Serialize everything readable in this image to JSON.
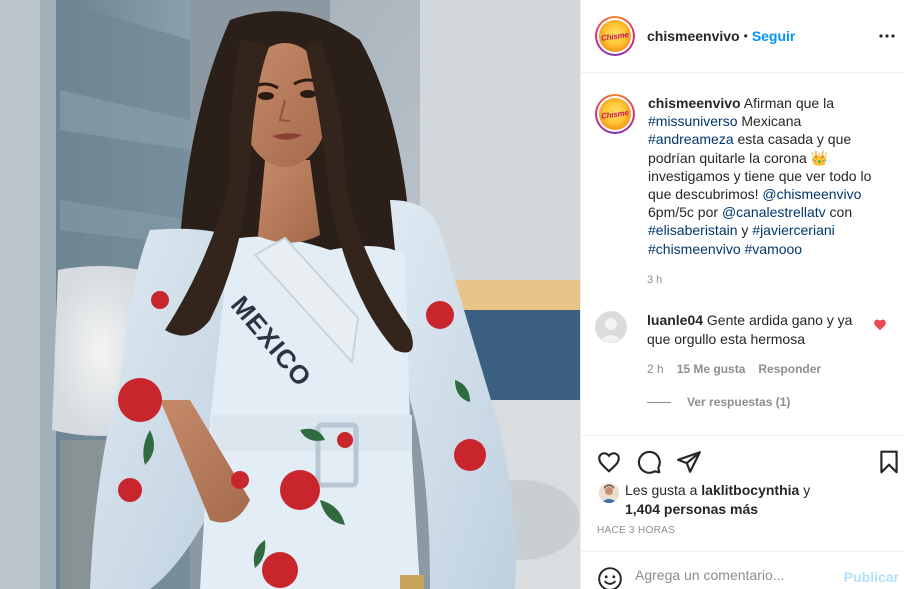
{
  "header": {
    "username": "chismeenvivo",
    "separator": "•",
    "follow_label": "Seguir",
    "more_icon": "more-horizontal-icon"
  },
  "caption": {
    "username": "chismeenvivo",
    "segments": [
      {
        "text": "Afirman que la ",
        "tag": false
      },
      {
        "text": "#missuniverso",
        "tag": true
      },
      {
        "text": " Mexicana ",
        "tag": false
      },
      {
        "text": "#andreameza",
        "tag": true
      },
      {
        "text": " esta casada y que podrían quitarle la corona 👑 investigamos y tiene que ver todo lo que descubrimos! ",
        "tag": false
      },
      {
        "text": "@chismeenvivo",
        "tag": true
      },
      {
        "text": " 6pm/5c por ",
        "tag": false
      },
      {
        "text": "@canalestrellatv",
        "tag": true
      },
      {
        "text": " con ",
        "tag": false
      },
      {
        "text": "#elisaberistain",
        "tag": true
      },
      {
        "text": " y ",
        "tag": false
      },
      {
        "text": "#javierceriani",
        "tag": true
      },
      {
        "text": " ",
        "tag": false
      },
      {
        "text": "#chismeenvivo",
        "tag": true
      },
      {
        "text": " ",
        "tag": false
      },
      {
        "text": "#vamooo",
        "tag": true
      }
    ],
    "time": "3 h"
  },
  "comment": {
    "username": "luanle04",
    "text": "Gente ardida gano y ya que orgullo esta hermosa",
    "time": "2 h",
    "likes": "15 Me gusta",
    "reply_label": "Responder",
    "view_replies": "Ver respuestas (1)"
  },
  "actions": {
    "like_icon": "heart-icon",
    "comment_icon": "comment-icon",
    "share_icon": "share-icon",
    "save_icon": "bookmark-icon"
  },
  "likes": {
    "prefix": "Les gusta a ",
    "user": "laklitbocynthia",
    "middle": " y",
    "count": "1,404 personas más"
  },
  "post_time": "HACE 3 HORAS",
  "add_comment": {
    "placeholder": "Agrega un comentario...",
    "publish_label": "Publicar"
  },
  "photo": {
    "sash_text": "MEXICO"
  },
  "avatar": {
    "text": "Chisme"
  },
  "colors": {
    "link": "#00376b",
    "follow": "#0095f6",
    "publish_disabled": "#b2dffc",
    "heart_liked": "#ed4956",
    "muted": "#8e8e8e"
  }
}
